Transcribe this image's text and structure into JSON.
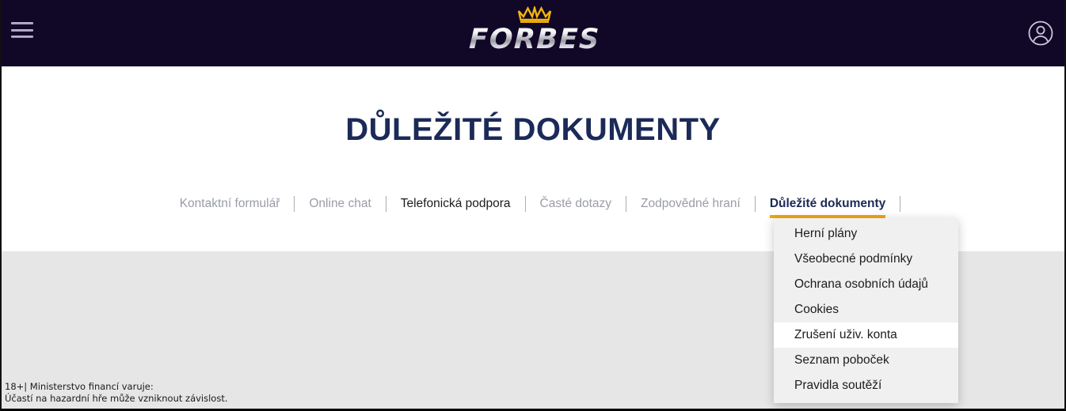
{
  "header": {
    "menu_icon": "hamburger-menu-icon",
    "brand_name": "FORBES",
    "brand_crown_icon": "crown-icon",
    "account_icon": "account-circle-icon",
    "background_color": "#110828"
  },
  "hero": {
    "title": "DŮLEŽITÉ DOKUMENTY",
    "title_color": "#1b2a57"
  },
  "tabs": [
    {
      "label": "Kontaktní formulář",
      "state": "default"
    },
    {
      "label": "Online chat",
      "state": "default"
    },
    {
      "label": "Telefonická podpora",
      "state": "hovered"
    },
    {
      "label": "Časté dotazy",
      "state": "default"
    },
    {
      "label": "Zodpovědné hraní",
      "state": "default"
    },
    {
      "label": "Důležité dokumenty",
      "state": "active"
    }
  ],
  "dropdown": {
    "accent_color": "#efa70d",
    "items": [
      {
        "label": "Herní plány",
        "state": "default"
      },
      {
        "label": "Všeobecné podmínky",
        "state": "default"
      },
      {
        "label": "Ochrana osobních údajů",
        "state": "default"
      },
      {
        "label": "Cookies",
        "state": "default"
      },
      {
        "label": "Zrušení uživ. konta",
        "state": "hovered"
      },
      {
        "label": "Seznam poboček",
        "state": "default"
      },
      {
        "label": "Pravidla soutěží",
        "state": "default"
      }
    ]
  },
  "footer": {
    "line1": "18+| Ministerstvo financí varuje:",
    "line2": "Účastí na hazardní hře může vzniknout závislost."
  }
}
